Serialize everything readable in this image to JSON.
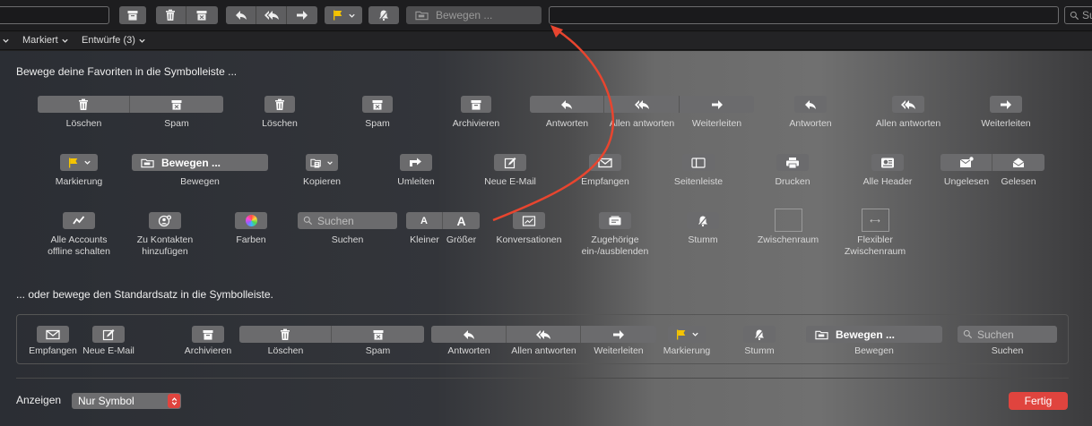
{
  "toolbar": {
    "move_placeholder": "Bewegen ...",
    "search_placeholder": "Su"
  },
  "subbar": {
    "flagged": "Markiert",
    "drafts": "Entwürfe (3)"
  },
  "sheet": {
    "heading_favorites": "Bewege deine Favoriten in die Symbolleiste ...",
    "heading_default": "... oder bewege den Standardsatz in die Symbolleiste.",
    "row1": {
      "delete_junk": [
        "Löschen",
        "Spam"
      ],
      "delete": "Löschen",
      "junk": "Spam",
      "archive": "Archivieren",
      "reply_group": [
        "Antworten",
        "Allen antworten",
        "Weiterleiten"
      ],
      "reply": "Antworten",
      "reply_all": "Allen antworten",
      "forward": "Weiterleiten"
    },
    "row2": {
      "flag": "Markierung",
      "move_button": "Bewegen ...",
      "move": "Bewegen",
      "copy": "Kopieren",
      "redirect": "Umleiten",
      "new_email": "Neue E-Mail",
      "get_mail": "Empfangen",
      "sidebar": "Seitenleiste",
      "print": "Drucken",
      "all_headers": "Alle Header",
      "unread_read": [
        "Ungelesen",
        "Gelesen"
      ]
    },
    "row3": {
      "offline": "Alle Accounts\noffline schalten",
      "add_contacts": "Zu Kontakten\nhinzufügen",
      "colors": "Farben",
      "search_placeholder": "Suchen",
      "search": "Suchen",
      "font_group": [
        "Kleiner",
        "Größer"
      ],
      "font_glyph": "A",
      "conversations": "Konversationen",
      "related": "Zugehörige\nein-/ausblenden",
      "mute": "Stumm",
      "space": "Zwischenraum",
      "flexible_space": "Flexibler\nZwischenraum"
    },
    "defaults": {
      "get_mail": "Empfangen",
      "new_email": "Neue E-Mail",
      "archive": "Archivieren",
      "delete_junk": [
        "Löschen",
        "Spam"
      ],
      "reply_group": [
        "Antworten",
        "Allen antworten",
        "Weiterleiten"
      ],
      "flag": "Markierung",
      "mute": "Stumm",
      "move_button": "Bewegen ...",
      "move": "Bewegen",
      "search_placeholder": "Suchen",
      "search": "Suchen"
    },
    "footer": {
      "show_label": "Anzeigen",
      "show_value": "Nur Symbol",
      "done": "Fertig"
    }
  },
  "colors": {
    "accent_red": "#e0443e",
    "annotation_arrow": "#e8452f",
    "flag_yellow": "#f5c400"
  }
}
